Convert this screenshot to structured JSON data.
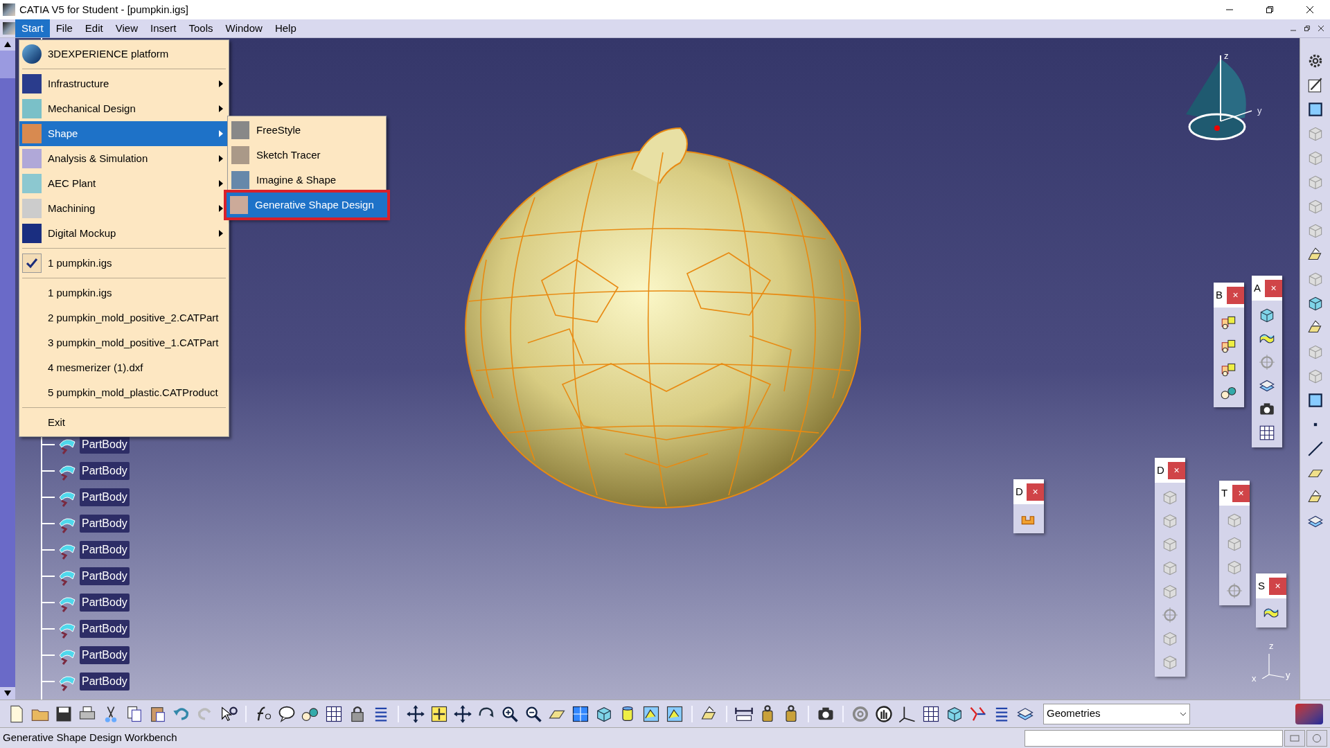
{
  "window": {
    "title": "CATIA V5 for Student - [pumpkin.igs]"
  },
  "menu_bar": [
    {
      "label": "Start",
      "selected": true
    },
    {
      "label": "File",
      "selected": false
    },
    {
      "label": "Edit",
      "selected": false
    },
    {
      "label": "View",
      "selected": false
    },
    {
      "label": "Insert",
      "selected": false
    },
    {
      "label": "Tools",
      "selected": false
    },
    {
      "label": "Window",
      "selected": false
    },
    {
      "label": "Help",
      "selected": false
    }
  ],
  "start_menu": {
    "platform": "3DEXPERIENCE platform",
    "workbenches": [
      {
        "label": "Infrastructure",
        "selected": false
      },
      {
        "label": "Mechanical Design",
        "selected": false
      },
      {
        "label": "Shape",
        "selected": true
      },
      {
        "label": "Analysis & Simulation",
        "selected": false
      },
      {
        "label": "AEC Plant",
        "selected": false
      },
      {
        "label": "Machining",
        "selected": false
      },
      {
        "label": "Digital Mockup",
        "selected": false
      }
    ],
    "open_documents": [
      {
        "label": "1 pumpkin.igs",
        "checked": true
      }
    ],
    "recent_files": [
      "1 pumpkin.igs",
      "2 pumpkin_mold_positive_2.CATPart",
      "3 pumpkin_mold_positive_1.CATPart",
      "4 mesmerizer (1).dxf",
      "5 pumpkin_mold_plastic.CATProduct"
    ],
    "exit": "Exit"
  },
  "shape_submenu": [
    {
      "label": "FreeStyle",
      "selected": false
    },
    {
      "label": "Sketch Tracer",
      "selected": false
    },
    {
      "label": "Imagine & Shape",
      "selected": false
    },
    {
      "label": "Generative Shape Design",
      "selected": true
    }
  ],
  "tree": [
    "PartBody",
    "PartBody",
    "PartBody",
    "PartBody",
    "PartBody",
    "PartBody",
    "PartBody",
    "PartBody",
    "PartBody",
    "PartBody"
  ],
  "compass": {
    "labels": [
      "z",
      "y"
    ]
  },
  "floating_toolbars": [
    {
      "title": "B",
      "close": "×"
    },
    {
      "title": "A",
      "close": "×"
    },
    {
      "title": "D",
      "close": "×"
    },
    {
      "title": "D",
      "close": "×"
    },
    {
      "title": "T",
      "close": "×"
    },
    {
      "title": "S",
      "close": "×"
    }
  ],
  "axes": {
    "labels": [
      "z",
      "y",
      "x"
    ]
  },
  "bottom_toolbar": {
    "dropdown": "Geometries"
  },
  "status_bar": {
    "text": "Generative Shape Design Workbench"
  }
}
